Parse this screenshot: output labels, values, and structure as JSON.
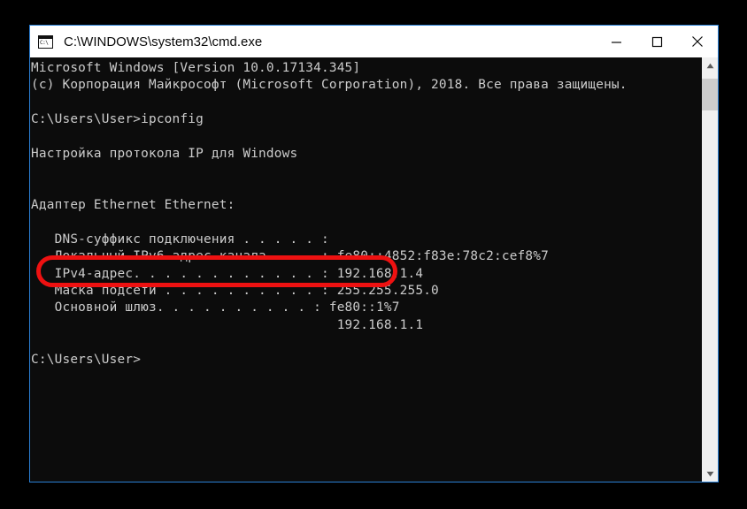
{
  "window": {
    "title": "C:\\WINDOWS\\system32\\cmd.exe",
    "icon": "cmd-console-icon",
    "border_color": "#2a7fd4",
    "titlebar_bg": "#ffffff",
    "console_bg": "#0c0c0c",
    "console_fg": "#cccccc",
    "controls": {
      "minimize": "—",
      "maximize": "☐",
      "close": "✕"
    }
  },
  "console": {
    "lines": [
      "Microsoft Windows [Version 10.0.17134.345]",
      "(c) Корпорация Майкрософт (Microsoft Corporation), 2018. Все права защищены.",
      "",
      "C:\\Users\\User>ipconfig",
      "",
      "Настройка протокола IP для Windows",
      "",
      "",
      "Адаптер Ethernet Ethernet:",
      "",
      "   DNS-суффикс подключения . . . . . :",
      "   Локальный IPv6-адрес канала . . . : fe80::4852:f83e:78c2:cef8%7",
      "   IPv4-адрес. . . . . . . . . . . . : 192.168.1.4",
      "   Маска подсети . . . . . . . . . . : 255.255.255.0",
      "   Основной шлюз. . . . . . . . . . : fe80::1%7",
      "                                       192.168.1.1",
      "",
      "C:\\Users\\User>"
    ]
  },
  "annotation": {
    "shape": "oval",
    "color": "#ee1111",
    "target_text": "IPv4-адрес. . . . . . . . . . . . : 192.168.1.4"
  },
  "scrollbar": {
    "up_arrow": "▲",
    "down_arrow": "▼",
    "track_color": "#f0f0f0",
    "thumb_color": "#cdcdcd"
  }
}
